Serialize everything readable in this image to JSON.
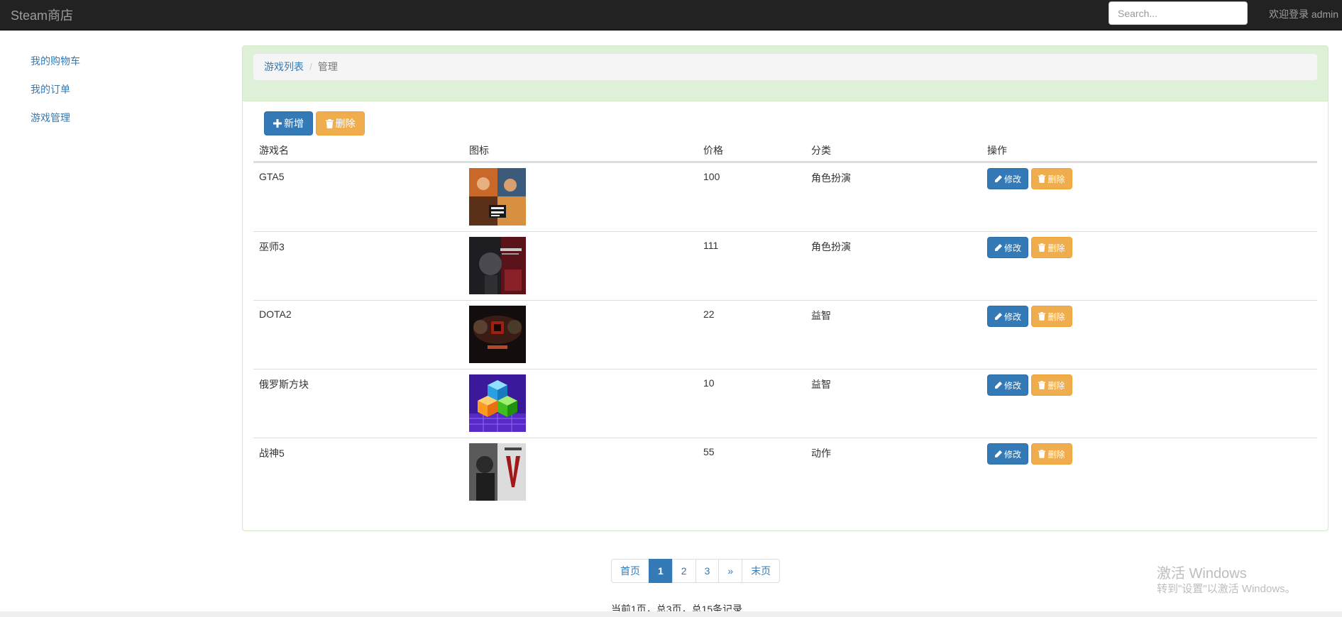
{
  "navbar": {
    "brand": "Steam商店",
    "search_placeholder": "Search...",
    "welcome": "欢迎登录 admin"
  },
  "sidebar": {
    "items": [
      {
        "label": "我的购物车"
      },
      {
        "label": "我的订单"
      },
      {
        "label": "游戏管理"
      }
    ]
  },
  "breadcrumb": {
    "link": "游戏列表",
    "separator": "/",
    "active": "管理"
  },
  "toolbar": {
    "add_label": "新增",
    "delete_label": "删除"
  },
  "table": {
    "headers": [
      "游戏名",
      "图标",
      "价格",
      "分类",
      "操作"
    ],
    "rows": [
      {
        "name": "GTA5",
        "icon": "gta5-cover",
        "price": "100",
        "category": "角色扮演",
        "edit": "修改",
        "delete": "删除"
      },
      {
        "name": "巫师3",
        "icon": "witcher3-cover",
        "price": "111",
        "category": "角色扮演",
        "edit": "修改",
        "delete": "删除"
      },
      {
        "name": "DOTA2",
        "icon": "dota2-cover",
        "price": "22",
        "category": "益智",
        "edit": "修改",
        "delete": "删除"
      },
      {
        "name": "俄罗斯方块",
        "icon": "tetris-cover",
        "price": "10",
        "category": "益智",
        "edit": "修改",
        "delete": "删除"
      },
      {
        "name": "战神5",
        "icon": "god-of-war-cover",
        "price": "55",
        "category": "动作",
        "edit": "修改",
        "delete": "删除"
      }
    ]
  },
  "pagination": {
    "first": "首页",
    "pages": [
      "1",
      "2",
      "3"
    ],
    "active_page": "1",
    "next": "»",
    "last": "末页",
    "info": "当前1页，总3页，总15条记录"
  },
  "watermark": {
    "line1": "激活 Windows",
    "line2": "转到\"设置\"以激活 Windows。"
  },
  "colors": {
    "navbar_bg": "#222222",
    "primary": "#337ab7",
    "warning": "#f0ad4e",
    "panel_heading": "#dff0d8"
  }
}
